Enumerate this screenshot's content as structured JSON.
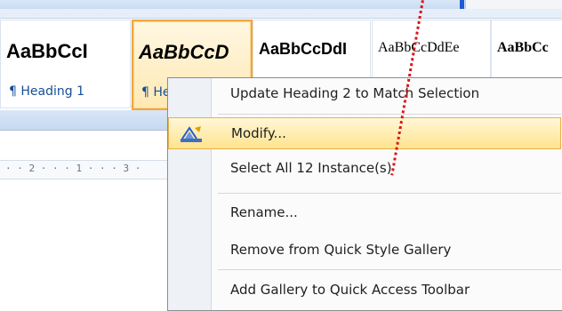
{
  "ribbon": {
    "styles": [
      {
        "sample": "AaBbCcI",
        "label": "¶ Heading 1"
      },
      {
        "sample": "AaBbCcD",
        "label": "¶ He"
      },
      {
        "sample": "AaBbCcDdI",
        "label": ""
      },
      {
        "sample": "AaBbCcDdEe",
        "label": ""
      },
      {
        "sample": "AaBbCc",
        "label": ""
      }
    ]
  },
  "ruler": {
    "text": "· · 2 · · · 1 · · · 3 ·"
  },
  "context_menu": {
    "items": [
      {
        "label": "Update Heading 2 to Match Selection",
        "icon": ""
      },
      {
        "label": "Modify...",
        "icon": "modify-style-icon"
      },
      {
        "label": "Select All 12 Instance(s)",
        "icon": ""
      },
      {
        "label": "Rename...",
        "icon": ""
      },
      {
        "label": "Remove from Quick Style Gallery",
        "icon": ""
      },
      {
        "label": "Add Gallery to Quick Access Toolbar",
        "icon": ""
      }
    ]
  },
  "colors": {
    "highlight": "#ffe38e",
    "selected_tile_border": "#f2a53b",
    "dotted_line": "#d7191c",
    "blue_marker": "#1f5bd6"
  }
}
